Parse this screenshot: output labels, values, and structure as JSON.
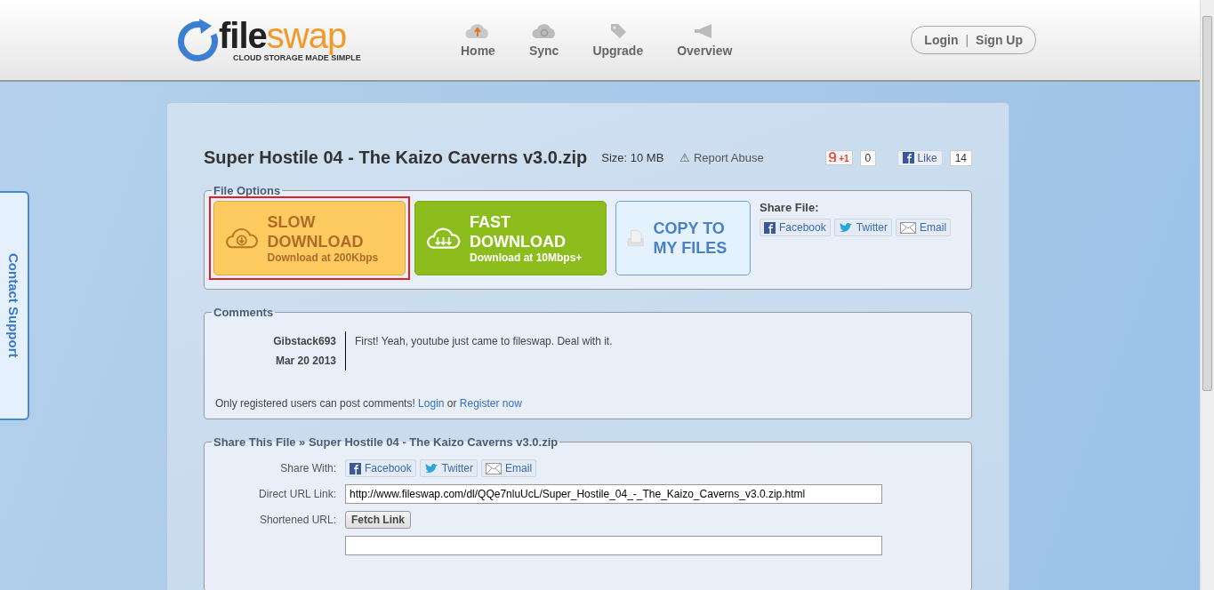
{
  "header": {
    "logo": {
      "name_dark": "file",
      "name_light": "swap",
      "tagline": "CLOUD STORAGE MADE SIMPLE"
    },
    "nav": [
      {
        "label": "Home",
        "kind": "upload"
      },
      {
        "label": "Sync",
        "kind": "sync"
      },
      {
        "label": "Upgrade",
        "kind": "tag"
      },
      {
        "label": "Overview",
        "kind": "megaphone"
      }
    ],
    "auth": {
      "login": "Login",
      "separator": "|",
      "signup": "Sign Up"
    }
  },
  "contact_tab": "Contact Support",
  "file": {
    "title": "Super Hostile 04 - The Kaizo Caverns v3.0.zip",
    "size_label": "Size:",
    "size": "10 MB",
    "report": "⚠ Report Abuse",
    "gplus": {
      "label": "+1",
      "count": "0"
    },
    "like": {
      "label": "Like",
      "count": "14"
    }
  },
  "file_options": {
    "legend": "File Options",
    "actions": [
      {
        "kind": "slow",
        "title": "SLOW DOWNLOAD",
        "subtitle": "Download at 200Kbps",
        "highlighted": true
      },
      {
        "kind": "fast",
        "title": "FAST DOWNLOAD",
        "subtitle": "Download at 10Mbps+",
        "highlighted": false
      },
      {
        "kind": "copy",
        "title": "COPY TO MY FILES",
        "highlighted": false
      }
    ],
    "share_label": "Share File:",
    "share": [
      {
        "kind": "facebook",
        "label": "Facebook"
      },
      {
        "kind": "twitter",
        "label": "Twitter"
      },
      {
        "kind": "email",
        "label": "Email"
      }
    ]
  },
  "comments": {
    "legend": "Comments",
    "items": [
      {
        "user": "Gibstack693",
        "date": "Mar 20 2013",
        "text": "First! Yeah, youtube just came to fileswap. Deal with it."
      }
    ],
    "notice": "Only registered users can post comments!",
    "login": "Login",
    "or": "or",
    "register": "Register now"
  },
  "share_file": {
    "legend": "Share This File » Super Hostile 04 - The Kaizo Caverns v3.0.zip",
    "share_with_label": "Share With:",
    "share": [
      {
        "kind": "facebook",
        "label": "Facebook"
      },
      {
        "kind": "twitter",
        "label": "Twitter"
      },
      {
        "kind": "email",
        "label": "Email"
      }
    ],
    "direct_label": "Direct URL Link:",
    "direct_url": "http://www.fileswap.com/dl/QQe7nluUcL/Super_Hostile_04_-_The_Kaizo_Caverns_v3.0.zip.html",
    "short_label": "Shortened URL:",
    "fetch": "Fetch Link"
  }
}
